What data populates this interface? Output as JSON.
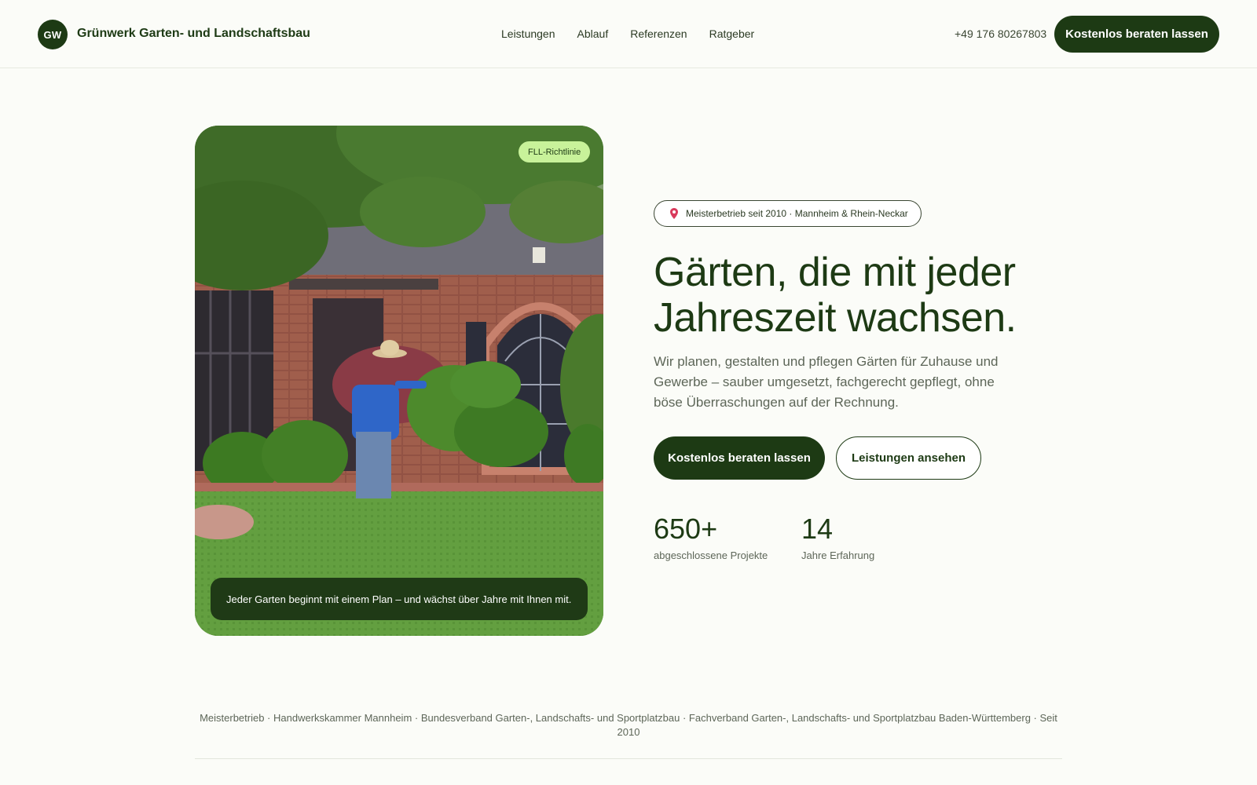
{
  "header": {
    "logo_initials": "GW",
    "brand_name": "Grünwerk Garten- und Landschaftsbau",
    "nav": [
      "Leistungen",
      "Ablauf",
      "Referenzen",
      "Ratgeber"
    ],
    "phone": "+49 176 80267803",
    "cta_label": "Kostenlos beraten lassen"
  },
  "hero": {
    "badge": "FLL-Richtlinie",
    "caption": "Jeder Garten beginnt mit einem Plan – und wächst über Jahre mit Ihnen mit.",
    "pill": "Meisterbetrieb seit 2010 · Mannheim & Rhein-Neckar",
    "headline": "Gärten, die mit jeder Jahreszeit wachsen.",
    "subtext": "Wir planen, gestalten und pflegen Gärten für Zuhause und Gewerbe – sauber umgesetzt, fachgerecht gepflegt, ohne böse Überraschungen auf der Rechnung.",
    "primary_cta": "Kostenlos beraten lassen",
    "secondary_cta": "Leistungen ansehen",
    "stats": [
      {
        "value": "650+",
        "label": "abgeschlossene Projekte"
      },
      {
        "value": "14",
        "label": "Jahre Erfahrung"
      }
    ]
  },
  "trust_line": "Meisterbetrieb · Handwerkskammer Mannheim · Bundesverband Garten-, Landschafts- und Sportplatzbau · Fachverband Garten-, Landschafts- und Sportplatzbau Baden-Württemberg · Seit 2010",
  "colors": {
    "brand_dark": "#1d3a14",
    "badge_green": "#c8f29a",
    "background": "#fbfcf8"
  }
}
